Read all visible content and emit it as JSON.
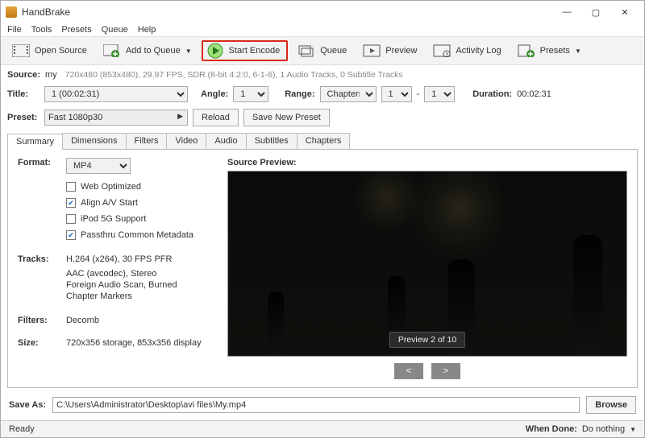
{
  "window": {
    "title": "HandBrake"
  },
  "menubar": {
    "items": [
      "File",
      "Tools",
      "Presets",
      "Queue",
      "Help"
    ]
  },
  "toolbar": {
    "open": "Open Source",
    "addq": "Add to Queue",
    "start": "Start Encode",
    "queue": "Queue",
    "preview": "Preview",
    "activity": "Activity Log",
    "presets": "Presets"
  },
  "source": {
    "label": "Source:",
    "name": "my",
    "info": "720x480 (853x480), 29.97 FPS, SDR (8-bit 4:2:0, 6-1-6), 1 Audio Tracks, 0 Subtitle Tracks"
  },
  "titleRow": {
    "titleLabel": "Title:",
    "titleValue": "1 (00:02:31)",
    "angleLabel": "Angle:",
    "angleValue": "1",
    "rangeLabel": "Range:",
    "rangeType": "Chapters",
    "rangeFrom": "1",
    "rangeDash": "-",
    "rangeTo": "1",
    "durationLabel": "Duration:",
    "durationValue": "00:02:31"
  },
  "presetRow": {
    "label": "Preset:",
    "value": "Fast 1080p30",
    "reload": "Reload",
    "savenew": "Save New Preset"
  },
  "tabs": [
    "Summary",
    "Dimensions",
    "Filters",
    "Video",
    "Audio",
    "Subtitles",
    "Chapters"
  ],
  "summary": {
    "formatLabel": "Format:",
    "formatValue": "MP4",
    "checks": {
      "web": {
        "label": "Web Optimized",
        "checked": false
      },
      "align": {
        "label": "Align A/V Start",
        "checked": true
      },
      "ipod": {
        "label": "iPod 5G Support",
        "checked": false
      },
      "passthru": {
        "label": "Passthru Common Metadata",
        "checked": true
      }
    },
    "tracksLabel": "Tracks:",
    "tracks": [
      "H.264 (x264), 30 FPS PFR",
      "AAC (avcodec), Stereo",
      "Foreign Audio Scan, Burned",
      "Chapter Markers"
    ],
    "filtersLabel": "Filters:",
    "filtersValue": "Decomb",
    "sizeLabel": "Size:",
    "sizeValue": "720x356 storage, 853x356 display"
  },
  "preview": {
    "title": "Source Preview:",
    "badge": "Preview 2 of 10",
    "prev": "<",
    "next": ">"
  },
  "save": {
    "label": "Save As:",
    "path": "C:\\Users\\Administrator\\Desktop\\avi files\\My.mp4",
    "browse": "Browse"
  },
  "status": {
    "ready": "Ready",
    "whenDoneLabel": "When Done:",
    "whenDoneValue": "Do nothing"
  }
}
